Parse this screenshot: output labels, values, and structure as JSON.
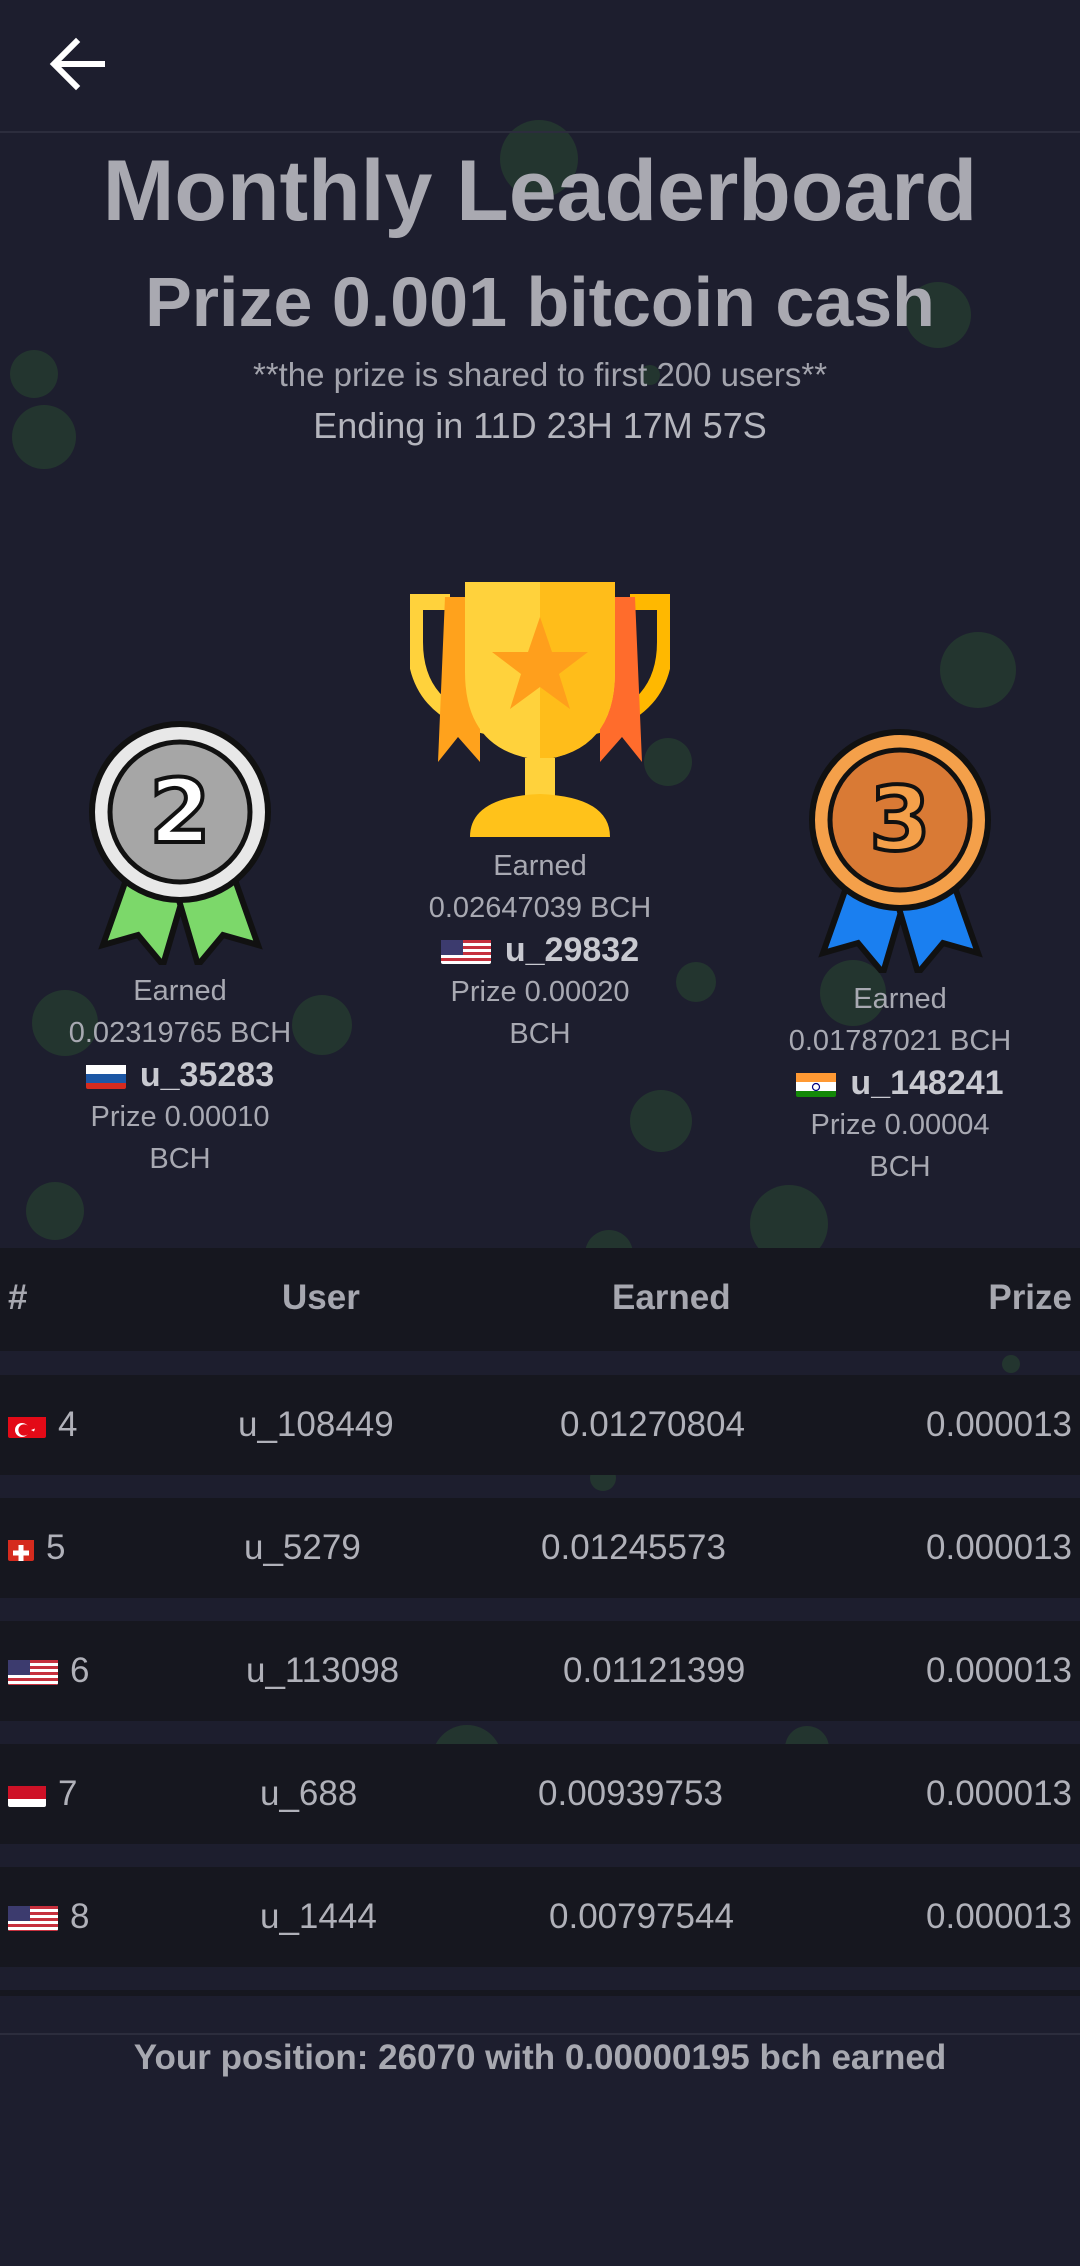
{
  "header": {
    "title": "Monthly Leaderboard",
    "prize": "Prize 0.001 bitcoin cash",
    "note": "**the prize is shared to first 200 users**",
    "ending": "Ending in 11D 23H 17M 57S"
  },
  "podium": {
    "first": {
      "earned_label": "Earned",
      "earned": "0.02647039 BCH",
      "user": "u_29832",
      "prize": "Prize 0.00020",
      "unit": "BCH",
      "flag": "US"
    },
    "second": {
      "earned_label": "Earned",
      "earned": "0.02319765 BCH",
      "user": "u_35283",
      "prize": "Prize 0.00010",
      "unit": "BCH",
      "flag": "RU",
      "medal_number": "2"
    },
    "third": {
      "earned_label": "Earned",
      "earned": "0.01787021 BCH",
      "user": "u_148241",
      "prize": "Prize 0.00004",
      "unit": "BCH",
      "flag": "IN",
      "medal_number": "3"
    }
  },
  "table": {
    "columns": [
      "#",
      "User",
      "Earned",
      "Prize"
    ],
    "rows": [
      {
        "rank": "4",
        "flag": "TR",
        "user": "u_108449",
        "earned": "0.01270804",
        "prize": "0.000013"
      },
      {
        "rank": "5",
        "flag": "CH",
        "user": "u_5279",
        "earned": "0.01245573",
        "prize": "0.000013"
      },
      {
        "rank": "6",
        "flag": "US",
        "user": "u_113098",
        "earned": "0.01121399",
        "prize": "0.000013"
      },
      {
        "rank": "7",
        "flag": "ID",
        "user": "u_688",
        "earned": "0.00939753",
        "prize": "0.000013"
      },
      {
        "rank": "8",
        "flag": "US",
        "user": "u_1444",
        "earned": "0.00797544",
        "prize": "0.000013"
      }
    ]
  },
  "footer": {
    "position": "Your position: 26070 with 0.00000195 bch earned"
  },
  "colors": {
    "background": "#1d1e2e",
    "row_background": "#16171f",
    "trophy_gold": "#ffd23c",
    "trophy_orange": "#ff9f1c",
    "silver": "#a6a6a6",
    "bronze": "#d97a35",
    "ribbon_green": "#7cd86a",
    "ribbon_blue": "#1a7ff0"
  }
}
